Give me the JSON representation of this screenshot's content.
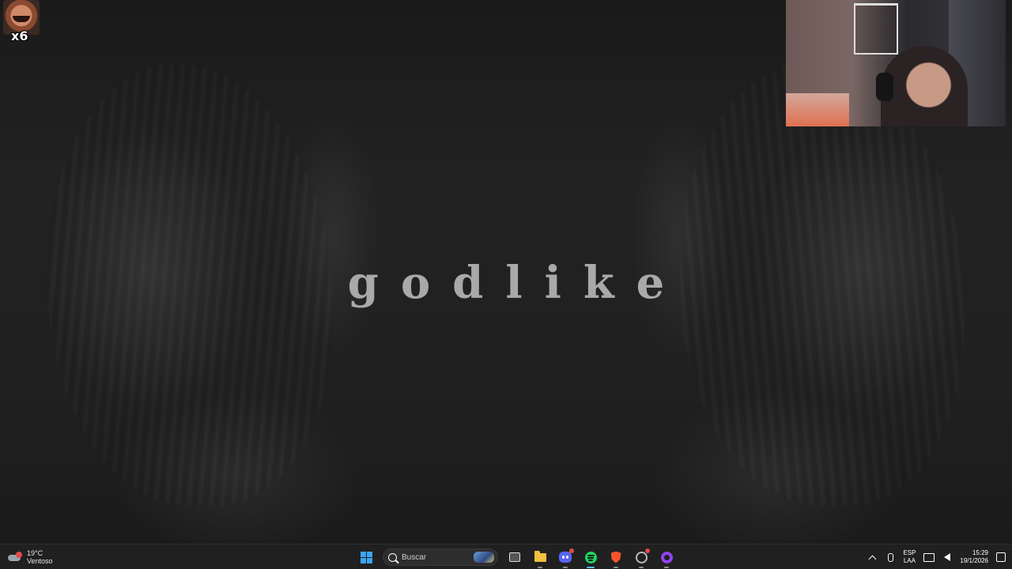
{
  "wallpaper": {
    "title": "godlike"
  },
  "overlay": {
    "emote_count": "x6"
  },
  "taskbar": {
    "weather": {
      "temperature": "19°C",
      "condition": "Ventoso"
    },
    "search": {
      "placeholder": "Buscar"
    },
    "apps": [
      {
        "name": "start",
        "icon": "windows-icon"
      },
      {
        "name": "search",
        "icon": "search-icon"
      },
      {
        "name": "task-view",
        "icon": "task-view-icon"
      },
      {
        "name": "file-explorer",
        "icon": "folder-icon"
      },
      {
        "name": "discord",
        "icon": "discord-icon",
        "badge": true
      },
      {
        "name": "spotify",
        "icon": "spotify-icon",
        "active": true
      },
      {
        "name": "brave",
        "icon": "brave-icon"
      },
      {
        "name": "obs",
        "icon": "obs-icon",
        "badge": true
      },
      {
        "name": "app",
        "icon": "circle-app-icon"
      }
    ],
    "tray": {
      "language": {
        "line1": "ESP",
        "line2": "LAA"
      },
      "time": "15:29",
      "date": "19/1/2026"
    }
  },
  "colors": {
    "taskbar_bg": "#202020",
    "accent": "#4cc2ff",
    "title_text": "#a9a9a9"
  }
}
